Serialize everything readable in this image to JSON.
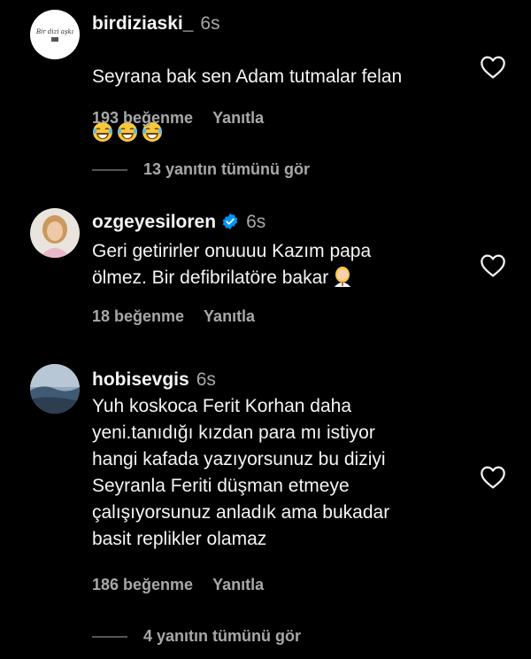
{
  "comments": [
    {
      "username": "birdiziaski_",
      "time": "6s",
      "text": "Seyrana bak sen Adam tutmalar felan",
      "avatar_text": "Bir dizi aşkı",
      "likes": "193 beğenme",
      "reply": "Yanıtla",
      "view_replies": "13 yanıtın tümünü gör"
    },
    {
      "username": "ozgeyesiloren",
      "time": "6s",
      "text": "Geri getirirler onuuuu Kazım papa\nölmez. Bir defibrilatöre bakar",
      "likes": "18 beğenme",
      "reply": "Yanıtla"
    },
    {
      "username": "hobisevgis",
      "time": "6s",
      "text": "Yuh koskoca Ferit Korhan daha\nyeni.tanıdığı kızdan para mı istiyor\nhangi kafada yazıyorsunuz bu diziyi\nSeyranla Feriti düşman etmeye\nçalışıyorsunuz anladık ama bukadar\nbasit replikler olamaz",
      "likes": "186 beğenme",
      "reply": "Yanıtla",
      "view_replies": "4 yanıtın tümünü gör"
    }
  ],
  "icons": {
    "heart": "heart-outline-icon",
    "verified": "verified-badge-icon",
    "laughing": "laughing-emoji-icon",
    "woman": "woman-health-worker-emoji-icon"
  },
  "colors": {
    "background": "#000000",
    "primary_text": "#f5f5f5",
    "secondary_text": "#a8a8a8",
    "verified": "#0095f6"
  }
}
